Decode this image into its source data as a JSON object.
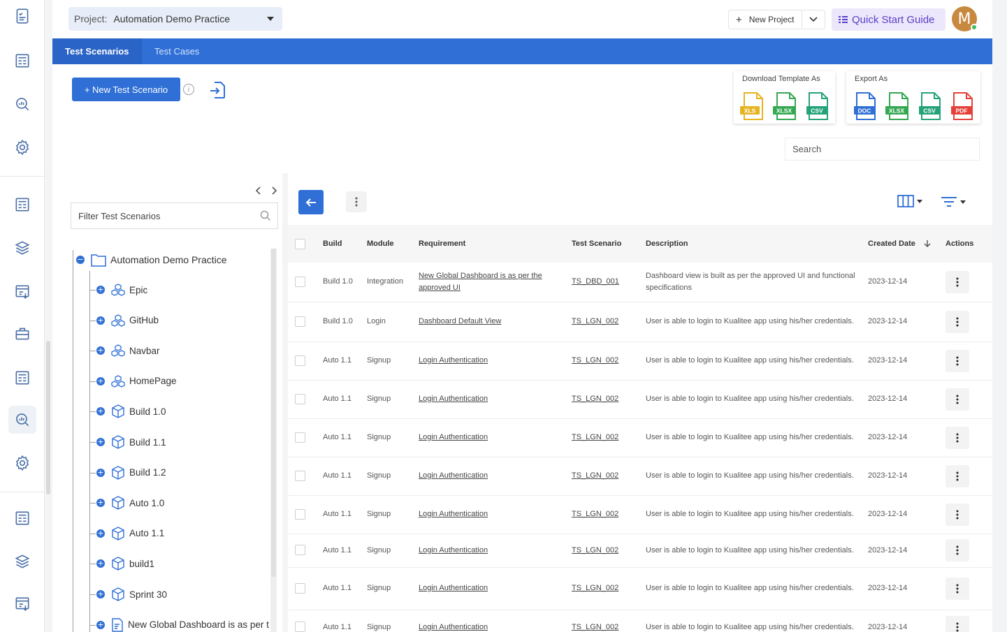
{
  "project": {
    "label": "Project:",
    "value": "Automation Demo Practice"
  },
  "header": {
    "new_project_label": "New Project",
    "quick_start_label": "Quick Start Guide",
    "avatar_initial": "M"
  },
  "tabs": [
    {
      "label": "Test Scenarios",
      "active": true
    },
    {
      "label": "Test Cases",
      "active": false
    }
  ],
  "toolbar": {
    "new_button_label": "+ New Test Scenario",
    "info_label": "i",
    "download_template": {
      "title": "Download Template As",
      "formats": [
        "XLS",
        "XLSX",
        "CSV"
      ]
    },
    "export_as": {
      "title": "Export As",
      "formats": [
        "DOC",
        "XLSX",
        "CSV",
        "PDF"
      ]
    },
    "search_placeholder": "Search"
  },
  "tree": {
    "filter_placeholder": "Filter Test Scenarios",
    "root": "Automation Demo Practice",
    "nodes": [
      {
        "label": "Epic",
        "icon": "modules-icon"
      },
      {
        "label": "GitHub",
        "icon": "modules-icon"
      },
      {
        "label": "Navbar",
        "icon": "modules-icon"
      },
      {
        "label": "HomePage",
        "icon": "modules-icon"
      },
      {
        "label": "Build 1.0",
        "icon": "cube-icon"
      },
      {
        "label": "Build 1.1",
        "icon": "cube-icon"
      },
      {
        "label": "Build 1.2",
        "icon": "cube-icon"
      },
      {
        "label": "Auto 1.0",
        "icon": "cube-icon"
      },
      {
        "label": "Auto 1.1",
        "icon": "cube-icon"
      },
      {
        "label": "build1",
        "icon": "cube-icon"
      },
      {
        "label": "Sprint 30",
        "icon": "cube-icon"
      },
      {
        "label": "New Global Dashboard is as per t",
        "icon": "document-icon"
      }
    ]
  },
  "grid": {
    "columns": [
      "Build",
      "Module",
      "Requirement",
      "Test Scenario",
      "Description",
      "Created Date",
      "Actions"
    ],
    "rows": [
      {
        "build": "Build 1.0",
        "module": "Integration",
        "requirement": "New Global Dashboard is as per the approved UI",
        "scenario": "TS_DBD_001",
        "description": "Dashboard view is built as per the approved UI and functional specifications",
        "date": "2023-12-14"
      },
      {
        "build": "Build 1.0",
        "module": "Login",
        "requirement": "Dashboard Default View",
        "scenario": "TS_LGN_002",
        "description": "User is able to login to Kualitee app using his/her credentials.",
        "date": "2023-12-14"
      },
      {
        "build": "Auto 1.1",
        "module": "Signup",
        "requirement": "Login Authentication",
        "scenario": "TS_LGN_002",
        "description": "User is able to login to Kualitee app using his/her credentials.",
        "date": "2023-12-14"
      },
      {
        "build": "Auto 1.1",
        "module": "Signup",
        "requirement": "Login Authentication",
        "scenario": "TS_LGN_002",
        "description": "User is able to login to Kualitee app using his/her credentials.",
        "date": "2023-12-14"
      },
      {
        "build": "Auto 1.1",
        "module": "Signup",
        "requirement": "Login Authentication",
        "scenario": "TS_LGN_002",
        "description": "User is able to login to Kualitee app using his/her credentials.",
        "date": "2023-12-14"
      },
      {
        "build": "Auto 1.1",
        "module": "Signup",
        "requirement": "Login Authentication",
        "scenario": "TS_LGN_002",
        "description": "User is able to login to Kualitee app using his/her credentials.",
        "date": "2023-12-14"
      },
      {
        "build": "Auto 1.1",
        "module": "Signup",
        "requirement": "Login Authentication",
        "scenario": "TS_LGN_002",
        "description": "User is able to login to Kualitee app using his/her credentials.",
        "date": "2023-12-14"
      },
      {
        "build": "Auto 1.1",
        "module": "Signup",
        "requirement": "Login Authentication",
        "scenario": "TS_LGN_002",
        "description": "User is able to login to Kualitee app using his/her credentials.",
        "date": "2023-12-14"
      },
      {
        "build": "Auto 1.1",
        "module": "Signup",
        "requirement": "Login Authentication",
        "scenario": "TS_LGN_002",
        "description": "User is able to login to Kualitee app using his/her credentials.",
        "date": "2023-12-14"
      },
      {
        "build": "Auto 1.1",
        "module": "Signup",
        "requirement": "Login Authentication",
        "scenario": "TS_LGN_002",
        "description": "User is able to login to Kualitee app using his/her credentials.",
        "date": "2023-12-14"
      }
    ]
  },
  "colors": {
    "primary": "#2f6fd6",
    "quick_start_bg": "#ece7fb",
    "quick_start_text": "#5b3ec8",
    "xls": "#e6b422",
    "xlsx": "#35a853",
    "csv": "#24a37a",
    "doc": "#2f6fd6",
    "pdf": "#e5413a"
  }
}
